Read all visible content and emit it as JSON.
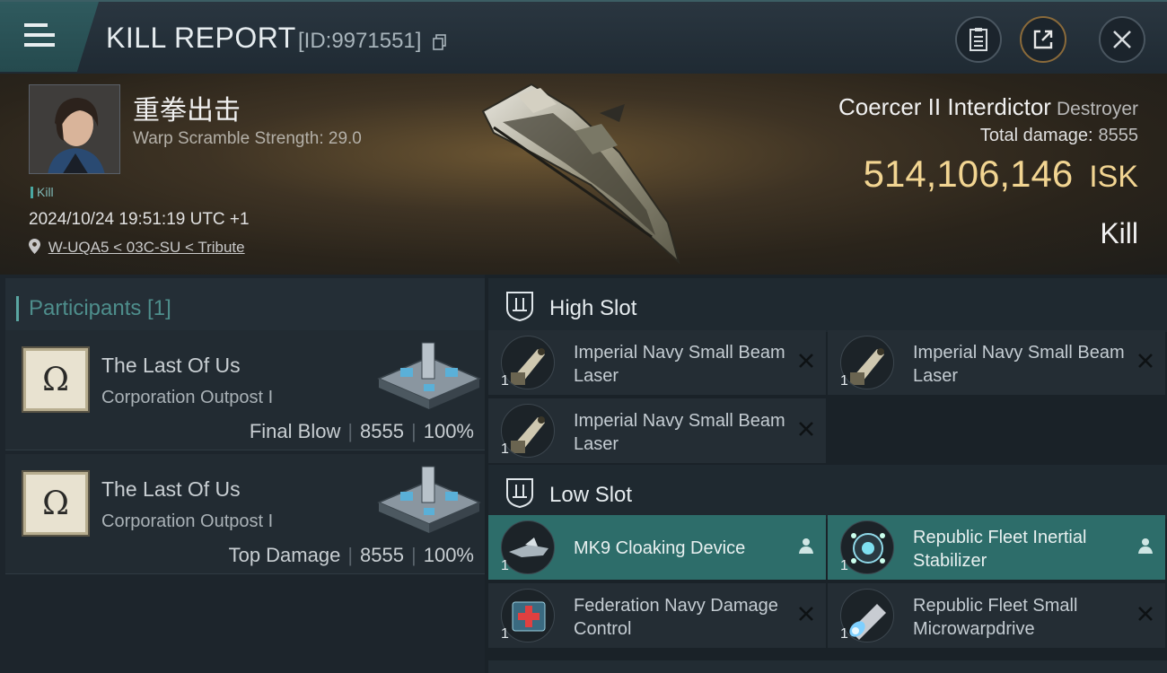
{
  "header": {
    "title": "KILL REPORT",
    "report_id": "[ID:9971551]"
  },
  "victim": {
    "pilot_name": "重拳出击",
    "warp_scramble": "Warp Scramble Strength: 29.0",
    "tag": "Kill",
    "timestamp": "2024/10/24 19:51:19 UTC +1",
    "location": "W-UQA5 < 03C-SU < Tribute"
  },
  "ship": {
    "name": "Coercer II Interdictor",
    "class": "Destroyer",
    "damage_label": "Total damage:",
    "damage_value": "8555",
    "isk_value": "514,106,146",
    "isk_unit": "ISK",
    "result": "Kill"
  },
  "participants": {
    "title": "Participants [1]",
    "items": [
      {
        "name": "The Last Of Us",
        "ship": "Corporation Outpost I",
        "role": "Final Blow",
        "damage": "8555",
        "percent": "100%",
        "logo_glyph": "Ω"
      },
      {
        "name": "The Last Of Us",
        "ship": "Corporation Outpost I",
        "role": "Top Damage",
        "damage": "8555",
        "percent": "100%",
        "logo_glyph": "Ω"
      }
    ]
  },
  "fitting": {
    "high_slot": {
      "title": "High Slot",
      "modules": [
        {
          "name": "Imperial Navy Small Beam Laser",
          "qty": "1",
          "status": "destroyed",
          "icon": "laser-turret-icon"
        },
        {
          "name": "Imperial Navy Small Beam Laser",
          "qty": "1",
          "status": "destroyed",
          "icon": "laser-turret-icon"
        },
        {
          "name": "Imperial Navy Small Beam Laser",
          "qty": "1",
          "status": "destroyed",
          "icon": "laser-turret-icon"
        }
      ]
    },
    "low_slot": {
      "title": "Low Slot",
      "modules": [
        {
          "name": "MK9 Cloaking Device",
          "qty": "1",
          "status": "dropped",
          "icon": "cloaking-device-icon"
        },
        {
          "name": "Republic Fleet Inertial Stabilizer",
          "qty": "1",
          "status": "dropped",
          "icon": "inertial-stabilizer-icon"
        },
        {
          "name": "Federation Navy Damage Control",
          "qty": "1",
          "status": "destroyed",
          "icon": "damage-control-icon"
        },
        {
          "name": "Republic Fleet Small Microwarpdrive",
          "qty": "1",
          "status": "destroyed",
          "icon": "microwarpdrive-icon"
        }
      ]
    }
  },
  "colors": {
    "accent_teal": "#2d6d6a",
    "isk_gold": "#f2d592",
    "participants_title": "#4e8e8c"
  }
}
